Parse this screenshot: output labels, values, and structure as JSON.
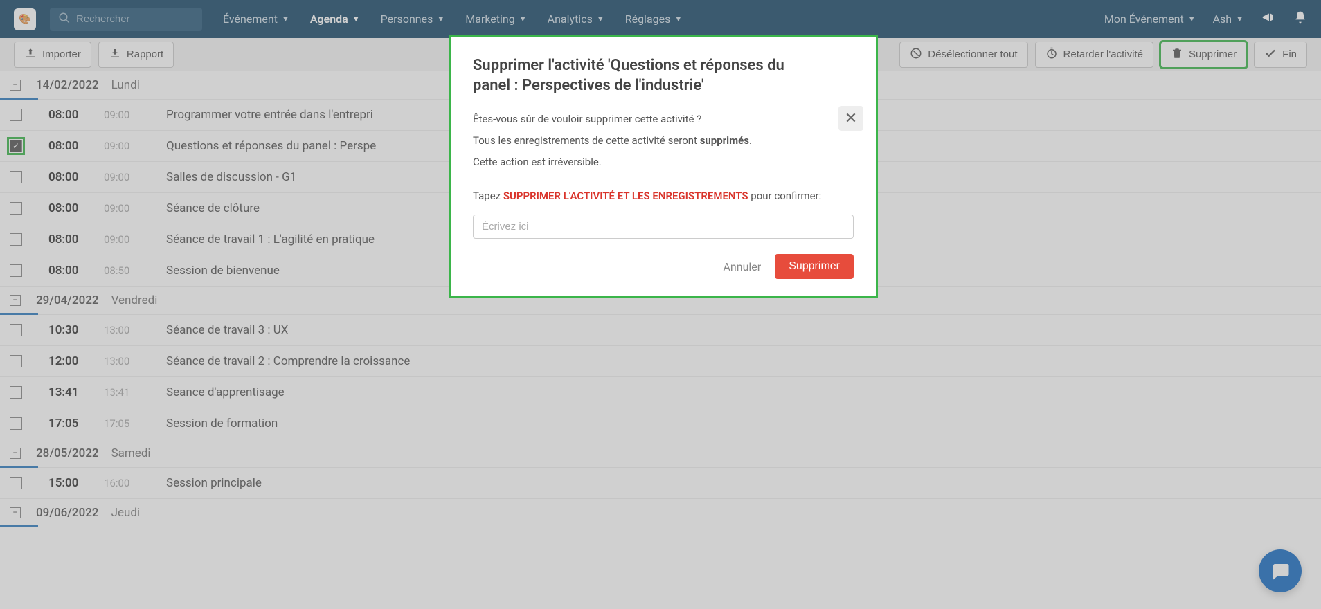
{
  "nav": {
    "search_placeholder": "Rechercher",
    "items": [
      "Événement",
      "Agenda",
      "Personnes",
      "Marketing",
      "Analytics",
      "Réglages"
    ],
    "active_index": 1,
    "right": {
      "event": "Mon Événement",
      "user": "Ash"
    }
  },
  "actions": {
    "import": "Importer",
    "report": "Rapport",
    "deselect": "Désélectionner tout",
    "delay": "Retarder l'activité",
    "delete": "Supprimer",
    "end": "Fin"
  },
  "groups": [
    {
      "date": "14/02/2022",
      "day": "Lundi",
      "rows": [
        {
          "start": "08:00",
          "end": "09:00",
          "title": "Programmer votre entrée dans l'entrepri",
          "checked": false
        },
        {
          "start": "08:00",
          "end": "09:00",
          "title": "Questions et réponses du panel : Perspe",
          "checked": true
        },
        {
          "start": "08:00",
          "end": "09:00",
          "title": "Salles de discussion - G1",
          "checked": false
        },
        {
          "start": "08:00",
          "end": "09:00",
          "title": "Séance de clôture",
          "checked": false
        },
        {
          "start": "08:00",
          "end": "09:00",
          "title": "Séance de travail 1 : L'agilité en pratique",
          "checked": false
        },
        {
          "start": "08:00",
          "end": "08:50",
          "title": "Session de bienvenue",
          "checked": false
        }
      ]
    },
    {
      "date": "29/04/2022",
      "day": "Vendredi",
      "rows": [
        {
          "start": "10:30",
          "end": "13:00",
          "title": "Séance de travail 3 : UX",
          "checked": false
        },
        {
          "start": "12:00",
          "end": "13:00",
          "title": "Séance de travail 2 : Comprendre la croissance",
          "checked": false
        },
        {
          "start": "13:41",
          "end": "13:41",
          "title": "Seance d'apprentisage",
          "checked": false
        },
        {
          "start": "17:05",
          "end": "17:05",
          "title": "Session de formation",
          "checked": false
        }
      ]
    },
    {
      "date": "28/05/2022",
      "day": "Samedi",
      "rows": [
        {
          "start": "15:00",
          "end": "16:00",
          "title": "Session principale",
          "checked": false
        }
      ]
    },
    {
      "date": "09/06/2022",
      "day": "Jeudi",
      "rows": []
    }
  ],
  "modal": {
    "title": "Supprimer l'activité 'Questions et réponses du panel : Perspectives de l'industrie'",
    "line1": "Êtes-vous sûr de vouloir supprimer cette activité ?",
    "line2_a": "Tous les enregistrements de cette activité seront ",
    "line2_b": "supprimés",
    "line2_c": ".",
    "line3": "Cette action est irréversible.",
    "confirm_a": "Tapez ",
    "confirm_b": "SUPPRIMER L'ACTIVITÉ ET LES ENREGISTREMENTS",
    "confirm_c": " pour confirmer:",
    "input_placeholder": "Écrivez ici",
    "cancel": "Annuler",
    "delete": "Supprimer"
  }
}
